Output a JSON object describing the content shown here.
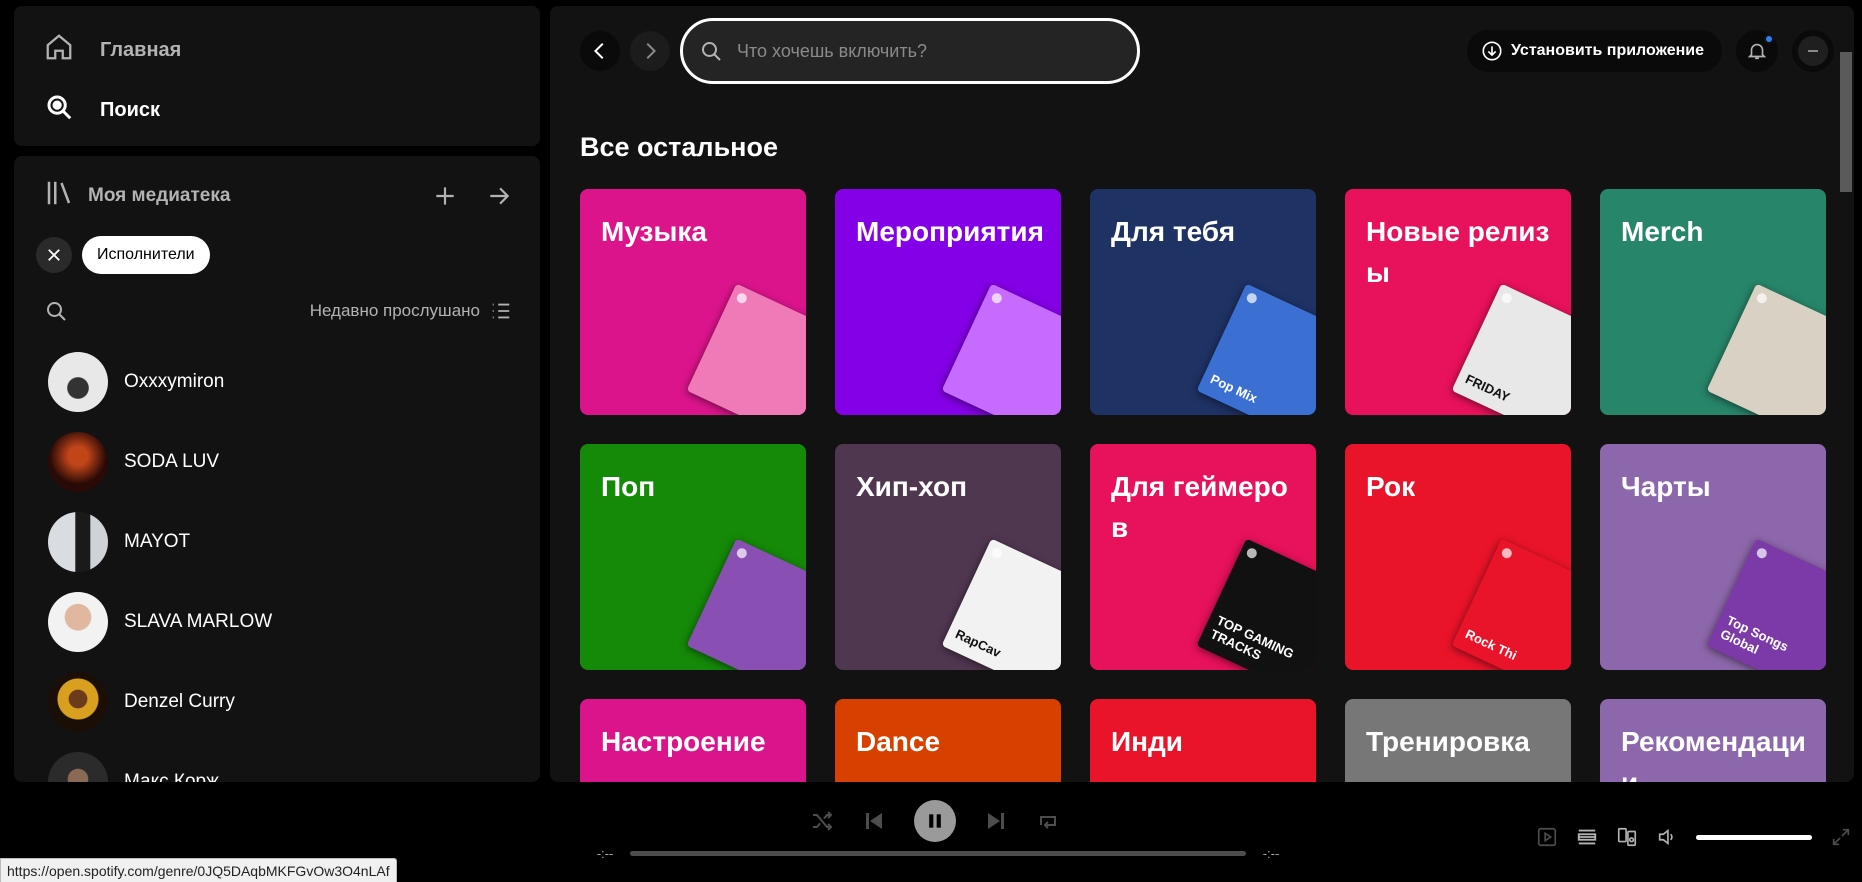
{
  "nav": {
    "home_label": "Главная",
    "search_label": "Поиск"
  },
  "library": {
    "title": "Моя медиатека",
    "filter_chip": "Исполнители",
    "sort_label": "Недавно прослушано",
    "artists": [
      {
        "name": "Oxxxymiron"
      },
      {
        "name": "SODA LUV"
      },
      {
        "name": "MAYOT"
      },
      {
        "name": "SLAVA MARLOW"
      },
      {
        "name": "Denzel Curry"
      },
      {
        "name": "Макс Корж"
      }
    ]
  },
  "topbar": {
    "search_placeholder": "Что хочешь включить?",
    "install_label": "Установить приложение"
  },
  "browse": {
    "section_title": "Все остальное",
    "categories": [
      {
        "title": "Музыка",
        "color": "#dc148c",
        "cover": "#f07ab8",
        "cover_label": ""
      },
      {
        "title": "Мероприятия",
        "color": "#8400e7",
        "cover": "#c76bff",
        "cover_label": ""
      },
      {
        "title": "Для тебя",
        "color": "#1e3264",
        "cover": "#3b6fd1",
        "cover_label": "Pop Mix"
      },
      {
        "title": "Новые релизы",
        "color": "#e8115b",
        "cover": "#e8e8e8",
        "cover_label": "FRIDAY"
      },
      {
        "title": "Merch",
        "color": "#27856a",
        "cover": "#d9d1c4",
        "cover_label": ""
      },
      {
        "title": "Поп",
        "color": "#148a08",
        "cover": "#8a4fb3",
        "cover_label": ""
      },
      {
        "title": "Хип-хоп",
        "color": "#503750",
        "cover": "#f2f2f2",
        "cover_label": "RapCav"
      },
      {
        "title": "Для геймеров",
        "color": "#e8115b",
        "cover": "#111111",
        "cover_label": "TOP GAMING TRACKS"
      },
      {
        "title": "Рок",
        "color": "#e91429",
        "cover": "#e91429",
        "cover_label": "Rock Thi"
      },
      {
        "title": "Чарты",
        "color": "#8d67ab",
        "cover": "#7c3aa8",
        "cover_label": "Top Songs Global"
      },
      {
        "title": "Настроение",
        "color": "#dc148c",
        "cover": "",
        "cover_label": ""
      },
      {
        "title": "Dance",
        "color": "#d84000",
        "cover": "",
        "cover_label": ""
      },
      {
        "title": "Инди",
        "color": "#e91429",
        "cover": "",
        "cover_label": ""
      },
      {
        "title": "Тренировка",
        "color": "#777777",
        "cover": "",
        "cover_label": ""
      },
      {
        "title": "Рекомендации",
        "color": "#8d67ab",
        "cover": "",
        "cover_label": ""
      }
    ]
  },
  "player": {
    "time_elapsed": "-:--",
    "time_total": "-:--",
    "volume": 1.0
  },
  "status_url": "https://open.spotify.com/genre/0JQ5DAqbMKFGvOw3O4nLAf"
}
